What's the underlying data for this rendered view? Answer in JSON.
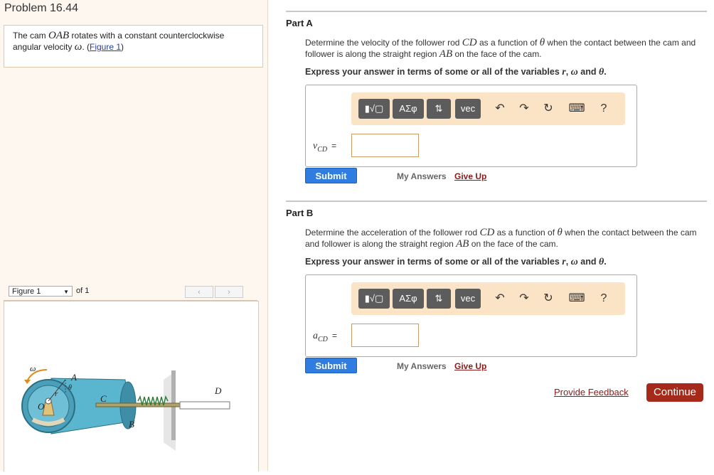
{
  "problem": {
    "title": "Problem 16.44"
  },
  "statement": {
    "t1": "The cam ",
    "m1": "OAB",
    "t2": " rotates with a constant counterclockwise angular velocity ",
    "m2": "ω",
    "t3": ". (",
    "link": "Figure 1",
    "t4": ")"
  },
  "figure_nav": {
    "selected": "Figure 1",
    "of": "of 1",
    "prev": "‹",
    "next": "›"
  },
  "figure": {
    "labels": {
      "omega": "ω",
      "A": "A",
      "C": "C",
      "D": "D",
      "B": "B",
      "O": "O",
      "r": "r",
      "theta": "θ"
    }
  },
  "parts": [
    {
      "title": "Part A",
      "q1": "Determine the velocity of the follower rod ",
      "qm1": "CD",
      "q2": " as a function of ",
      "qm2": "θ",
      "q3": " when the contact between the cam and follower is along the straight region ",
      "qm3": "AB",
      "q4": " on the face of the cam.",
      "instr": "Express your answer in terms of some or all of the variables ",
      "iv1": "r",
      "iv2": "ω",
      "iv3": "θ",
      "var": "v",
      "var_sub": "CD",
      "eq": "=",
      "submit": "Submit",
      "my_answers": "My Answers",
      "give_up": "Give Up"
    },
    {
      "title": "Part B",
      "q1": "Determine the acceleration of the follower rod ",
      "qm1": "CD",
      "q2": " as a function of ",
      "qm2": "θ",
      "q3": " when the contact between the cam and follower is along the straight region ",
      "qm3": "AB",
      "q4": " on the face of the cam.",
      "instr": "Express your answer in terms of some or all of the variables ",
      "iv1": "r",
      "iv2": "ω",
      "iv3": "θ",
      "var": "a",
      "var_sub": "CD",
      "eq": "=",
      "submit": "Submit",
      "my_answers": "My Answers",
      "give_up": "Give Up"
    }
  ],
  "toolbar": {
    "templates": "▮√▢",
    "greek": "ΑΣφ",
    "arrows": "⇅",
    "vec": "vec",
    "undo": "↶",
    "redo": "↷",
    "reset": "↻",
    "keyboard": "⌨",
    "help": "?"
  },
  "text": {
    "comma": ", ",
    "and": " and ",
    "period": "."
  },
  "footer": {
    "feedback": "Provide Feedback",
    "continue": "Continue"
  },
  "colors": {
    "accent": "#2f7de1",
    "continue_bg": "#a52a1a",
    "toolbar_bg": "#fbe4c6",
    "cam": "#5ab6cf"
  }
}
